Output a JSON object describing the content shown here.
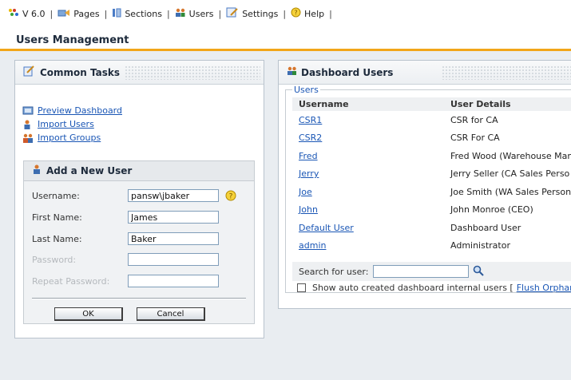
{
  "topnav": {
    "version": "V 6.0",
    "separator": "|",
    "items": [
      {
        "label": "Pages",
        "icon": "pages-icon"
      },
      {
        "label": "Sections",
        "icon": "sections-icon"
      },
      {
        "label": "Users",
        "icon": "users-icon"
      },
      {
        "label": "Settings",
        "icon": "settings-icon"
      },
      {
        "label": "Help",
        "icon": "help-icon"
      }
    ]
  },
  "page_title": "Users Management",
  "common_tasks": {
    "title": "Common Tasks",
    "tasks": [
      {
        "label": "Preview Dashboard",
        "icon": "preview-icon"
      },
      {
        "label": "Import Users",
        "icon": "import-user-icon"
      },
      {
        "label": "Import Groups",
        "icon": "import-groups-icon"
      }
    ],
    "add_user": {
      "title": "Add a New User",
      "username_label": "Username:",
      "username_value": "pansw\\jbaker",
      "first_name_label": "First Name:",
      "first_name_value": "James",
      "last_name_label": "Last Name:",
      "last_name_value": "Baker",
      "password_label": "Password:",
      "repeat_password_label": "Repeat Password:",
      "ok_label": "OK",
      "cancel_label": "Cancel"
    }
  },
  "dashboard_users": {
    "title": "Dashboard Users",
    "legend": "Users",
    "columns": [
      "Username",
      "User Details"
    ],
    "rows": [
      {
        "username": "CSR1",
        "details": "CSR for CA"
      },
      {
        "username": "CSR2",
        "details": "CSR For CA"
      },
      {
        "username": "Fred",
        "details": "Fred Wood (Warehouse Mana"
      },
      {
        "username": "Jerry",
        "details": "Jerry Seller (CA Sales Perso"
      },
      {
        "username": "Joe",
        "details": "Joe Smith (WA Sales Person)"
      },
      {
        "username": "John",
        "details": "John Monroe (CEO)"
      },
      {
        "username": "Default User",
        "details": "Dashboard User"
      },
      {
        "username": "admin",
        "details": "Administrator"
      }
    ],
    "search_label": "Search for user:",
    "show_auto_label": "Show auto created dashboard internal users [",
    "flush_link": "Flush Orphar"
  },
  "colors": {
    "accent": "#f2a619",
    "link": "#1a56b5",
    "background": "#e9edf1"
  }
}
